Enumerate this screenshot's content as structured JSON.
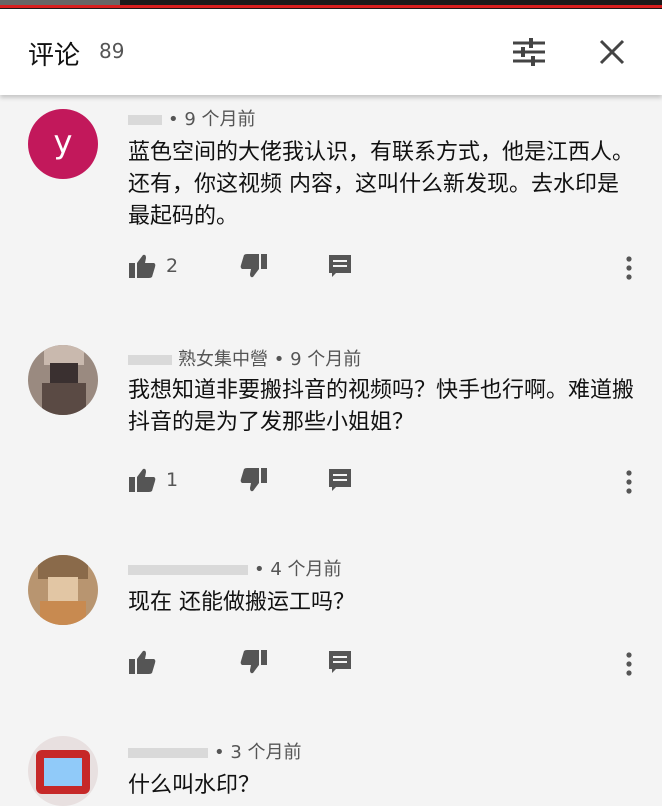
{
  "header": {
    "title": "评论",
    "count": "89"
  },
  "comments": [
    {
      "avatar_letter": "y",
      "time": "• 9 个月前",
      "text": "蓝色空间的大佬我认识，有联系方式，他是江西人。还有，你这视频 内容，这叫什么新发现。去水印是最起码的。",
      "likes": "2"
    },
    {
      "author_partial": "熟女集中營",
      "time": "• 9 个月前",
      "text": "我想知道非要搬抖音的视频吗？快手也行啊。难道搬抖音的是为了发那些小姐姐？",
      "likes": "1"
    },
    {
      "time": "• 4 个月前",
      "text": "现在 还能做搬运工吗？",
      "likes": ""
    },
    {
      "time": "• 3 个月前",
      "text": "什么叫水印？",
      "likes": ""
    }
  ],
  "colors": {
    "avatar_y": "#c2185b",
    "background": "#f4f4f4",
    "header_bg": "#ffffff"
  },
  "icons": [
    "filter-icon",
    "close-icon",
    "like-icon",
    "dislike-icon",
    "reply-icon",
    "more-vert-icon"
  ]
}
